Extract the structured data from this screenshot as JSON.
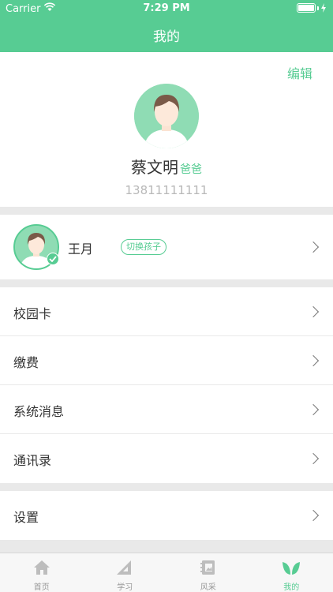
{
  "status_bar": {
    "carrier": "Carrier",
    "time": "7:29 PM"
  },
  "nav": {
    "title": "我的"
  },
  "profile": {
    "edit_label": "编辑",
    "name": "蔡文明",
    "relation": "爸爸",
    "phone": "13811111111"
  },
  "child": {
    "name": "王月",
    "switch_label": "切换孩子"
  },
  "menu": {
    "items": [
      {
        "label": "校园卡"
      },
      {
        "label": "缴费"
      },
      {
        "label": "系统消息"
      },
      {
        "label": "通讯录"
      }
    ],
    "settings": {
      "label": "设置"
    }
  },
  "tabbar": {
    "tabs": [
      {
        "label": "首页",
        "icon": "home-icon"
      },
      {
        "label": "学习",
        "icon": "ruler-icon"
      },
      {
        "label": "风采",
        "icon": "photo-book-icon"
      },
      {
        "label": "我的",
        "icon": "leaf-icon"
      }
    ],
    "active_index": 3
  },
  "colors": {
    "accent": "#57cc93",
    "background": "#e9e9e9",
    "text": "#333333",
    "muted": "#b8b8b8"
  }
}
